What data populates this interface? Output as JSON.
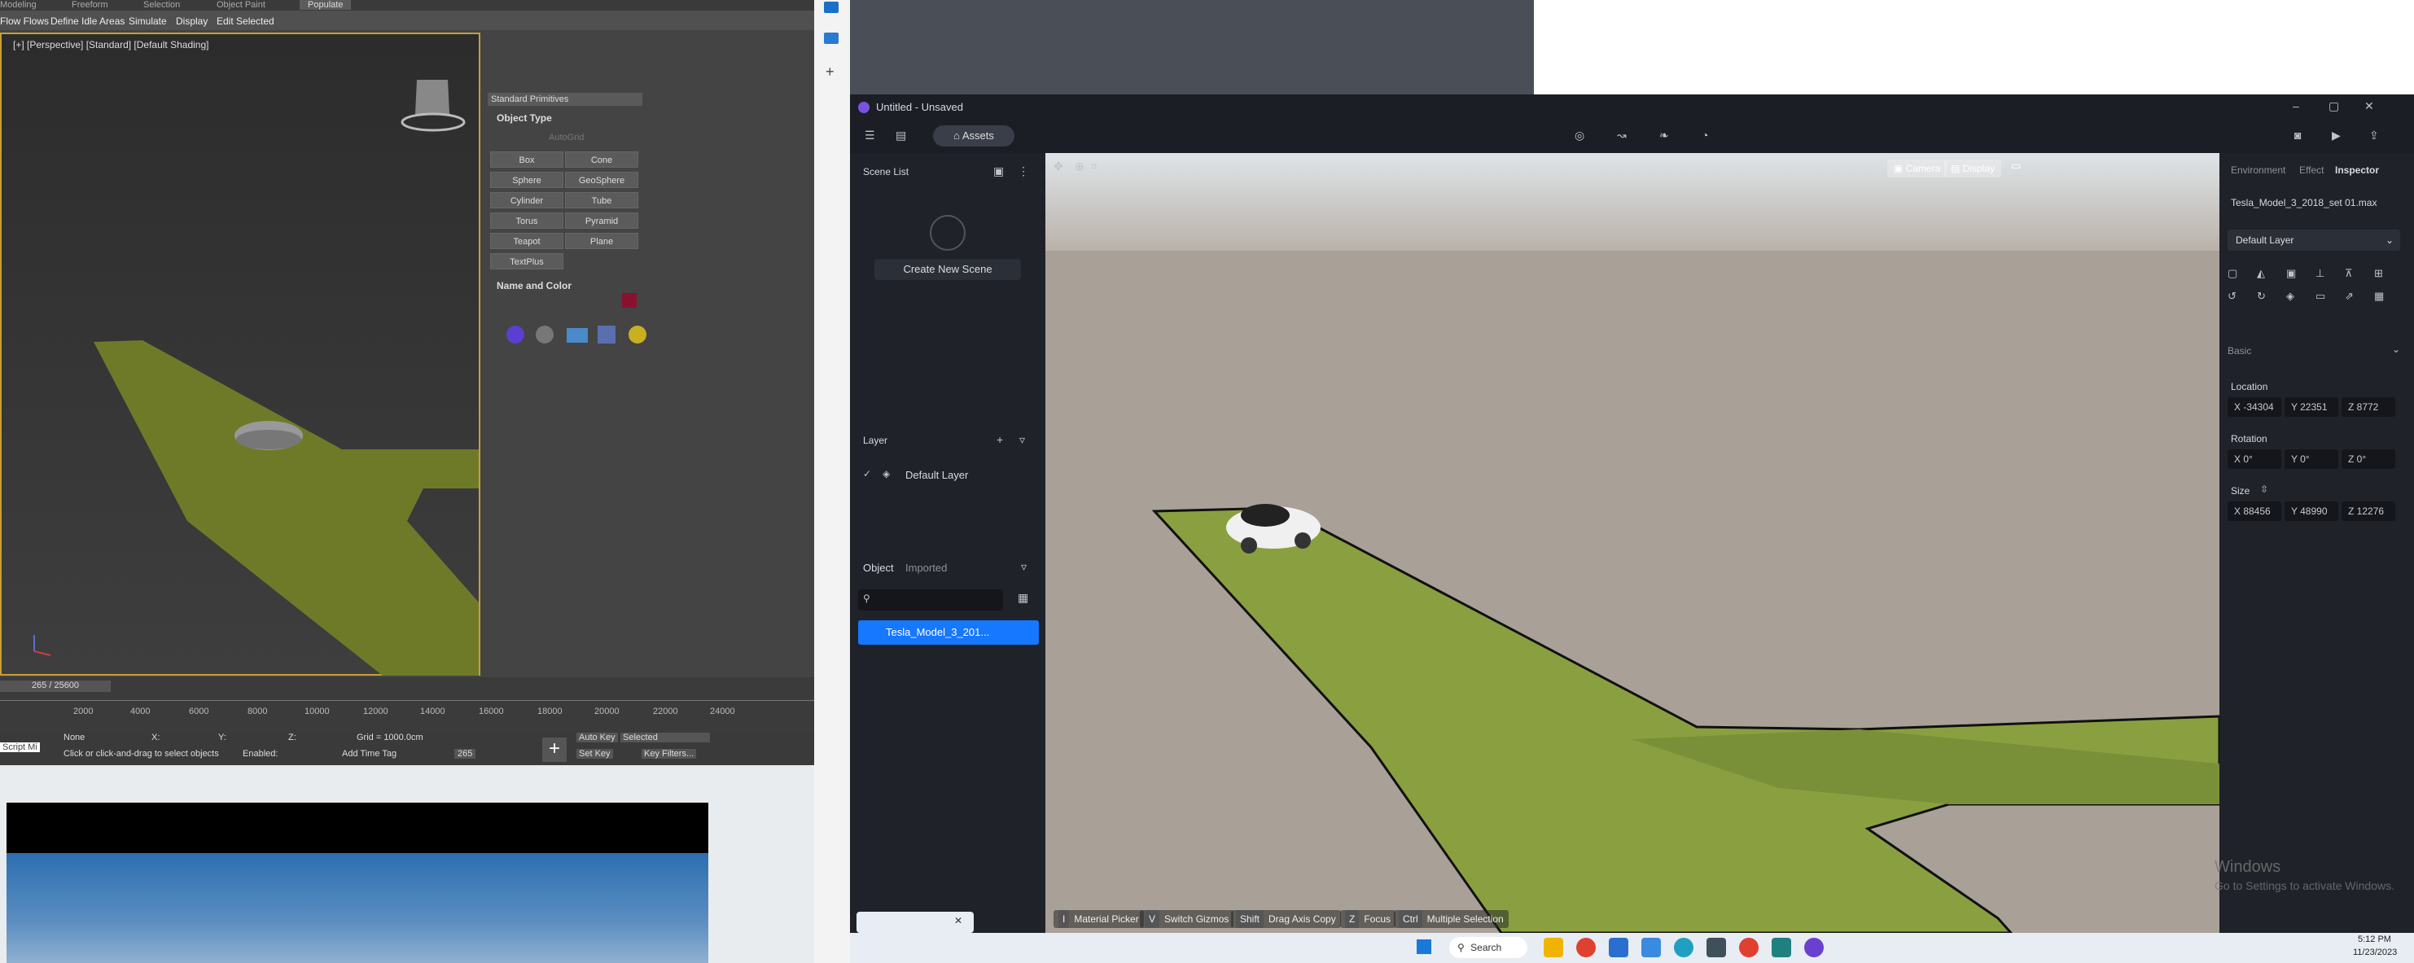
{
  "max": {
    "tabs": [
      "Modeling",
      "Freeform",
      "Selection",
      "Object Paint",
      "Populate"
    ],
    "ribbon": [
      "Flow Flows",
      "Define Idle Areas",
      "Simulate",
      "Display",
      "Edit Selected"
    ],
    "viewport_label": "[+] [Perspective] [Standard] [Default Shading]",
    "dropdown": "Standard Primitives",
    "object_type_title": "Object Type",
    "autogrid": "AutoGrid",
    "primitives": [
      "Box",
      "Cone",
      "Sphere",
      "GeoSphere",
      "Cylinder",
      "Tube",
      "Torus",
      "Pyramid",
      "Teapot",
      "Plane",
      "TextPlus"
    ],
    "name_color_title": "Name and Color",
    "frame_counter": "265 / 25600",
    "ticks": [
      "2000",
      "4000",
      "6000",
      "8000",
      "10000",
      "12000",
      "14000",
      "16000",
      "18000",
      "20000",
      "22000",
      "24000"
    ],
    "status": {
      "script": "Script Mi",
      "none": "None",
      "x_label": "X:",
      "y_label": "Y:",
      "z_label": "Z:",
      "grid": "Grid = 1000.0cm",
      "prompt": "Click or click-and-drag to select objects",
      "enabled": "Enabled:",
      "add_time_tag": "Add Time Tag",
      "auto_key": "Auto Key",
      "selected": "Selected",
      "set_key": "Set Key",
      "key_filters": "Key Filters...",
      "frame": "265"
    }
  },
  "app": {
    "title": "Untitled - Unsaved",
    "assets_button": "Assets",
    "scene_list": "Scene List",
    "create_new_scene": "Create New Scene",
    "layer_title": "Layer",
    "default_layer": "Default Layer",
    "object_tab": "Object",
    "imported_tab": "Imported",
    "object_item": "Tesla_Model_3_201...",
    "viewport_buttons": [
      "Camera",
      "Display"
    ],
    "hints": [
      {
        "key": "I",
        "label": "Material Picker"
      },
      {
        "key": "V",
        "label": "Switch Gizmos"
      },
      {
        "key": "Shift",
        "label": "Drag Axis Copy"
      },
      {
        "key": "Z",
        "label": "Focus"
      },
      {
        "key": "Ctrl",
        "label": "Multiple Selection"
      }
    ],
    "inspector": {
      "tabs": [
        "Environment",
        "Effect",
        "Inspector"
      ],
      "object_name": "Tesla_Model_3_2018_set 01.max",
      "layer_select": "Default Layer",
      "basic": "Basic",
      "location_label": "Location",
      "location": {
        "x": "X -34304",
        "y": "Y 22351",
        "z": "Z 8772"
      },
      "rotation_label": "Rotation",
      "rotation": {
        "x": "X 0°",
        "y": "Y 0°",
        "z": "Z 0°"
      },
      "size_label": "Size",
      "size": {
        "x": "X 88456",
        "y": "Y 48990",
        "z": "Z 12276"
      }
    },
    "watermark": [
      "Windows",
      "Go to Settings to activate Windows."
    ]
  },
  "taskbar": {
    "search": "Search",
    "time": "5:12 PM",
    "date": "11/23/2023"
  }
}
